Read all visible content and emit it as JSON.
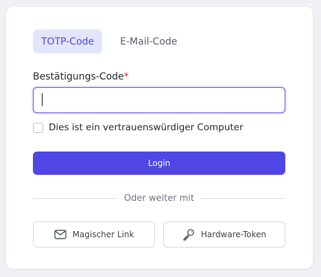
{
  "tabs": {
    "totp_label": "TOTP-Code",
    "email_label": "E-Mail-Code"
  },
  "form": {
    "code_label": "Bestätigungs-Code",
    "required_marker": "*",
    "code_value": "",
    "trusted_label": "Dies ist ein vertrauenswürdiger Computer",
    "trusted_checked": false,
    "login_label": "Login"
  },
  "alternatives": {
    "divider_text": "Oder weiter mit",
    "magic_link_label": "Magischer Link",
    "hardware_token_label": "Hardware-Token"
  },
  "icons": {
    "magic_link": "mail-icon",
    "hardware_token": "key-icon"
  },
  "colors": {
    "accent": "#5046e5",
    "required": "#dc2626",
    "tab_active_bg": "#e3e6fb"
  }
}
